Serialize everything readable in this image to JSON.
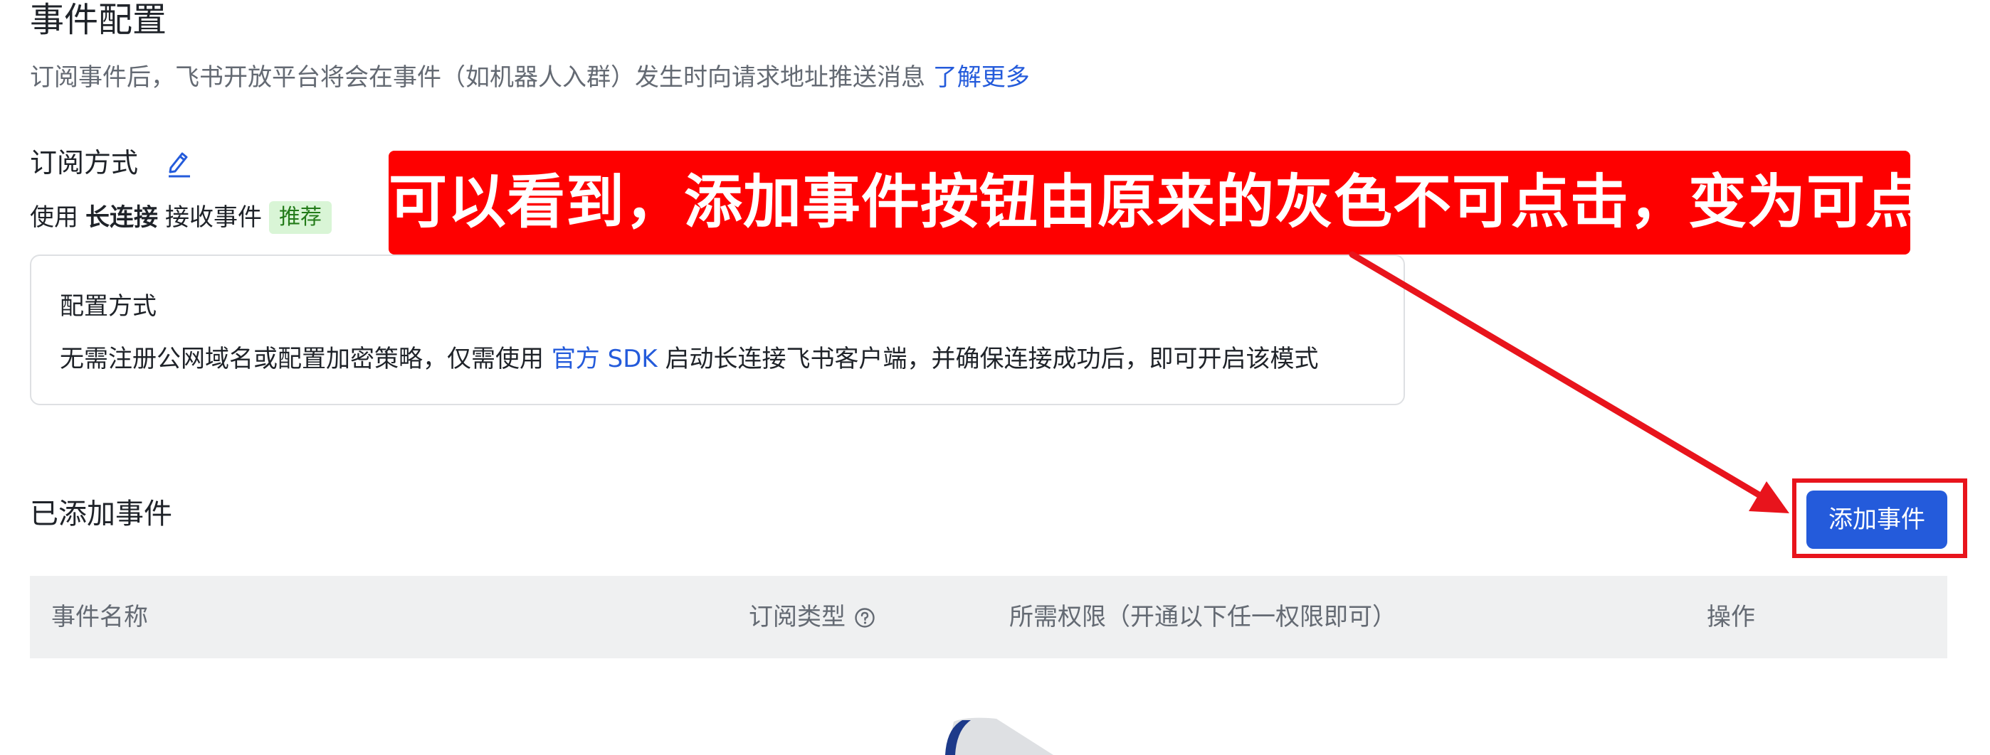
{
  "header": {
    "title": "事件配置",
    "description": "订阅事件后，飞书开放平台将会在事件（如机器人入群）发生时向请求地址推送消息",
    "learn_more": "了解更多"
  },
  "subscription": {
    "title": "订阅方式",
    "prefix": "使用",
    "mode": "长连接",
    "suffix": "接收事件",
    "tag": "推荐"
  },
  "config_card": {
    "title": "配置方式",
    "desc_before": "无需注册公网域名或配置加密策略，仅需使用",
    "sdk_link": "官方 SDK",
    "desc_after": "启动长连接飞书客户端，并确保连接成功后，即可开启该模式"
  },
  "events": {
    "section_title": "已添加事件",
    "add_button": "添加事件",
    "columns": [
      "事件名称",
      "订阅类型",
      "所需权限（开通以下任一权限即可）",
      "操作"
    ]
  },
  "annotation": {
    "callout": "可以看到，添加事件按钮由原来的灰色不可点击，变为可点击",
    "color": "#fe0000"
  },
  "icons": {
    "edit": "edit-icon",
    "help": "help-circle-icon",
    "empty": "empty-state-illustration"
  },
  "colors": {
    "primary": "#245bdb",
    "tag_bg": "#d9f5d6",
    "tag_text": "#237b19",
    "annotation": "#e8141c"
  }
}
